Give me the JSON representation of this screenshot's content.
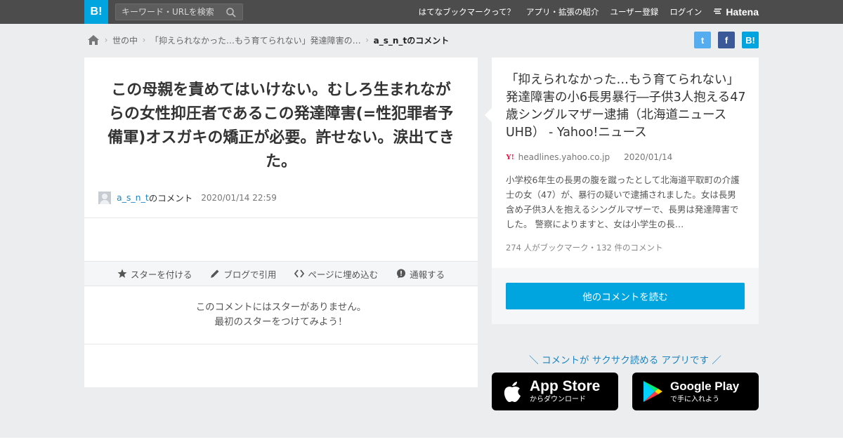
{
  "header": {
    "logo": "B!",
    "search_placeholder": "キーワード・URLを検索",
    "nav": [
      "はてなブックマークって？",
      "アプリ・拡張の紹介",
      "ユーザー登録",
      "ログイン"
    ],
    "brand": "Hatena"
  },
  "breadcrumb": {
    "items": [
      "世の中",
      "「抑えられなかった…もう育てられない」発達障害の…"
    ],
    "current": "a_s_n_tのコメント"
  },
  "share": {
    "twitter": "t",
    "facebook": "f",
    "hatena": "B!"
  },
  "comment": {
    "text": "この母親を責めてはいけない。むしろ生まれながらの女性抑圧者であるこの発達障害(=性犯罪者予備軍)オスガキの矯正が必要。許せない。涙出てきた。",
    "author": "a_s_n_t",
    "author_suffix": "のコメント",
    "timestamp": "2020/01/14 22:59",
    "actions": [
      "スターを付ける",
      "ブログで引用",
      "ページに埋め込む",
      "通報する"
    ],
    "no_star_line1": "このコメントにはスターがありません。",
    "no_star_line2": "最初のスターをつけてみよう！"
  },
  "article": {
    "title": "「抑えられなかった…もう育てられない」発達障害の小6長男暴行―子供3人抱える47歳シングルマザー逮捕（北海道ニュースUHB） - Yahoo!ニュース",
    "source_icon": "Y!",
    "source": "headlines.yahoo.co.jp",
    "date": "2020/01/14",
    "summary": "小学校6年生の長男の腹を蹴ったとして北海道平取町の介護士の女（47）が、暴行の疑いで逮捕されました。女は長男含め子供3人を抱えるシングルマザーで、長男は発達障害でした。 警察によりますと、女は小学生の長…",
    "meta": "274 人がブックマーク・132 件のコメント",
    "read_button": "他のコメントを読む"
  },
  "apps": {
    "promo": "＼ コメントが サクサク読める アプリです ／",
    "appstore_main": "App Store",
    "appstore_sub": "からダウンロード",
    "googleplay_main": "Google Play",
    "googleplay_sub": "で手に入れよう"
  },
  "colors": {
    "accent": "#00a4de",
    "header": "#4c4c4c",
    "link": "#1d86c2"
  }
}
